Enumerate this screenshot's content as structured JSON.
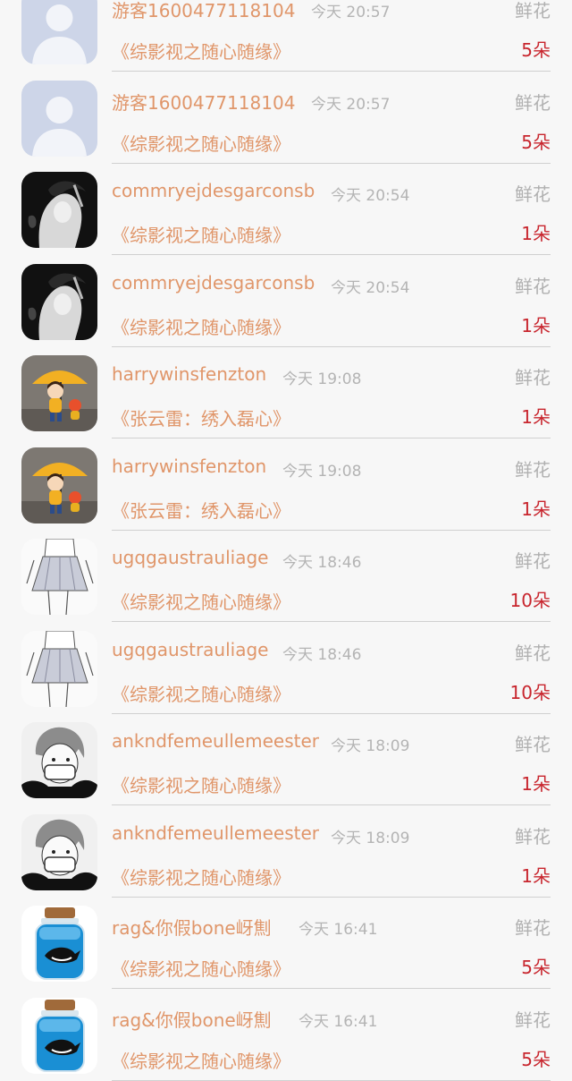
{
  "gift_label": "鲜花",
  "rows": [
    {
      "user": "游客1600477118104",
      "time": "今天 20:57",
      "book": "《综影视之随心随缘》",
      "count": "5朵",
      "avatar": "default-avatar-icon"
    },
    {
      "user": "游客1600477118104",
      "time": "今天 20:57",
      "book": "《综影视之随心随缘》",
      "count": "5朵",
      "avatar": "default-avatar-icon"
    },
    {
      "user": "commryejdesgarconsb",
      "time": "今天 20:54",
      "book": "《综影视之随心随缘》",
      "count": "1朵",
      "avatar": "smoking-portrait-icon"
    },
    {
      "user": "commryejdesgarconsb",
      "time": "今天 20:54",
      "book": "《综影视之随心随缘》",
      "count": "1朵",
      "avatar": "smoking-portrait-icon"
    },
    {
      "user": "harrywinsfenzton",
      "time": "今天 19:08",
      "book": "《张云雷：绣入磊心》",
      "count": "1朵",
      "avatar": "umbrella-girl-icon"
    },
    {
      "user": "harrywinsfenzton",
      "time": "今天 19:08",
      "book": "《张云雷：绣入磊心》",
      "count": "1朵",
      "avatar": "umbrella-girl-icon"
    },
    {
      "user": "ugqgaustrauliage",
      "time": "今天 18:46",
      "book": "《综影视之随心随缘》",
      "count": "10朵",
      "avatar": "skirt-sketch-icon"
    },
    {
      "user": "ugqgaustrauliage",
      "time": "今天 18:46",
      "book": "《综影视之随心随缘》",
      "count": "10朵",
      "avatar": "skirt-sketch-icon"
    },
    {
      "user": "ankndfemeullemeester",
      "time": "今天 18:09",
      "book": "《综影视之随心随缘》",
      "count": "1朵",
      "avatar": "masked-boy-icon"
    },
    {
      "user": "ankndfemeullemeester",
      "time": "今天 18:09",
      "book": "《综影视之随心随缘》",
      "count": "1朵",
      "avatar": "masked-boy-icon"
    },
    {
      "user": "rag&你假bone岈劁",
      "time": "今天 16:41",
      "book": "《综影视之随心随缘》",
      "count": "5朵",
      "avatar": "whale-jar-icon"
    },
    {
      "user": "rag&你假bone岈劁",
      "time": "今天 16:41",
      "book": "《综影视之随心随缘》",
      "count": "5朵",
      "avatar": "whale-jar-icon"
    }
  ]
}
